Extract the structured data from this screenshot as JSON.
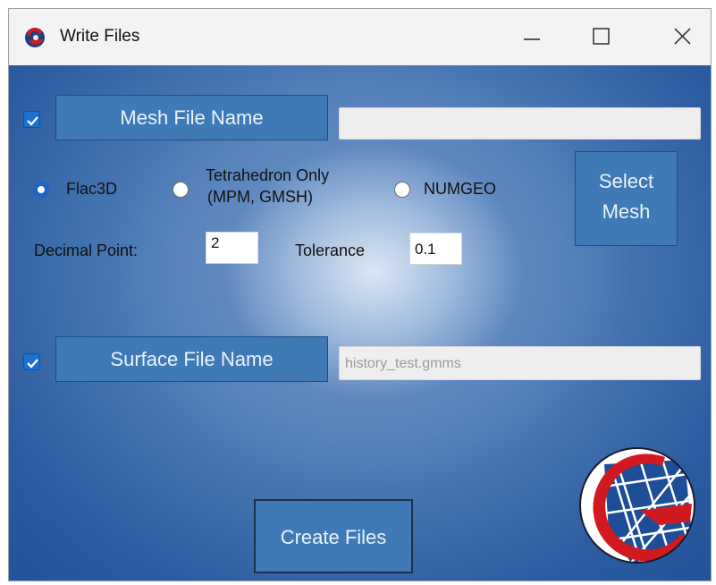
{
  "window": {
    "title": "Write Files",
    "controls": {
      "minimize": "—",
      "maximize": "☐",
      "close": "✕"
    }
  },
  "mesh": {
    "checkbox_checked": true,
    "button_label": "Mesh File Name",
    "filename_value": "",
    "formats": [
      {
        "label": "Flac3D",
        "selected": true
      },
      {
        "label_line1": "Tetrahedron Only",
        "label_line2": "(MPM, GMSH)",
        "selected": false
      },
      {
        "label": "NUMGEO",
        "selected": false
      }
    ],
    "select_button": {
      "line1": "Select",
      "line2": "Mesh"
    },
    "decimal_point_label": "Decimal Point:",
    "decimal_point_value": "2",
    "tolerance_label": "Tolerance",
    "tolerance_value": "0.1"
  },
  "surface": {
    "checkbox_checked": true,
    "button_label": "Surface File Name",
    "filename_value": "history_test.gmms"
  },
  "actions": {
    "create_label": "Create Files"
  },
  "colors": {
    "accent": "#1e63c9",
    "button_bg": "#3f7ab6",
    "background_dark": "#1f4f95",
    "logo_red": "#d11a1f"
  },
  "icons": {
    "app_icon": "app-logo-icon",
    "brand_logo": "brand-logo-g-mesh-icon"
  }
}
